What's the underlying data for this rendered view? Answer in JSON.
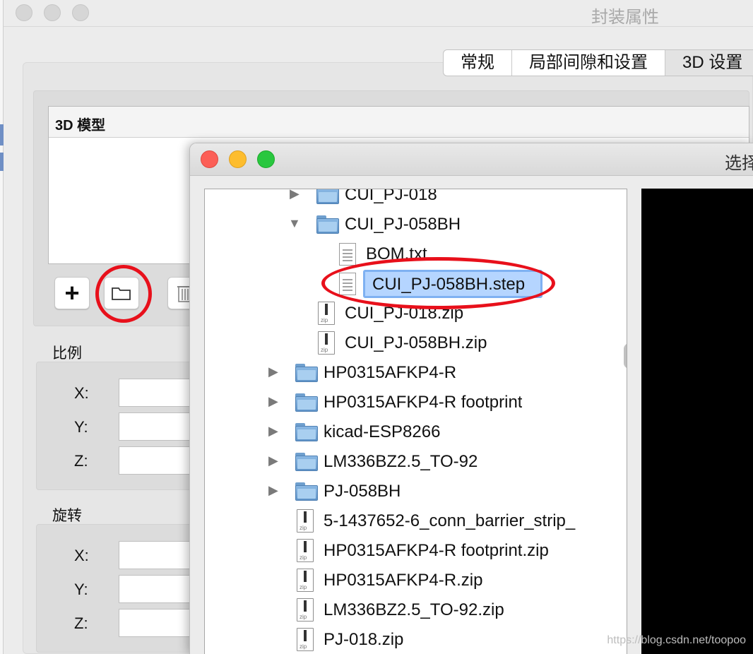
{
  "back_window": {
    "title": "封装属性",
    "tabs": [
      {
        "label": "常规"
      },
      {
        "label": "局部间隙和设置"
      },
      {
        "label": "3D 设置"
      }
    ],
    "model_list_header": "3D 模型",
    "toolbar": {
      "add_icon": "plus-icon",
      "open_icon": "folder-icon",
      "delete_icon": "trash-icon"
    },
    "scale": {
      "label": "比例",
      "axes": [
        {
          "label": "X:"
        },
        {
          "label": "Y:"
        },
        {
          "label": "Z:"
        }
      ]
    },
    "rotation": {
      "label": "旋转",
      "axes": [
        {
          "label": "X:"
        },
        {
          "label": "Y:"
        },
        {
          "label": "Z:"
        }
      ]
    }
  },
  "dialog": {
    "title": "选择",
    "tree": [
      {
        "label": "CUI_PJ-018",
        "type": "folder",
        "expanded": false
      },
      {
        "label": "CUI_PJ-058BH",
        "type": "folder",
        "expanded": true
      },
      {
        "label": "BOM.txt",
        "type": "text-file"
      },
      {
        "label": "CUI_PJ-058BH.step",
        "type": "text-file",
        "editing": true
      },
      {
        "label": "CUI_PJ-018.zip",
        "type": "zip-file"
      },
      {
        "label": "CUI_PJ-058BH.zip",
        "type": "zip-file"
      },
      {
        "label": "HP0315AFKP4-R",
        "type": "folder",
        "expanded": false
      },
      {
        "label": "HP0315AFKP4-R footprint",
        "type": "folder",
        "expanded": false
      },
      {
        "label": "kicad-ESP8266",
        "type": "folder",
        "expanded": false
      },
      {
        "label": "LM336BZ2.5_TO-92",
        "type": "folder",
        "expanded": false
      },
      {
        "label": "PJ-058BH",
        "type": "folder",
        "expanded": false
      },
      {
        "label": "5-1437652-6_conn_barrier_strip_",
        "type": "zip-file"
      },
      {
        "label": "HP0315AFKP4-R footprint.zip",
        "type": "zip-file"
      },
      {
        "label": "HP0315AFKP4-R.zip",
        "type": "zip-file"
      },
      {
        "label": "LM336BZ2.5_TO-92.zip",
        "type": "zip-file"
      },
      {
        "label": "PJ-018.zip",
        "type": "zip-file"
      }
    ]
  },
  "annotation_color": "#e8101b",
  "watermark": "https://blog.csdn.net/toopoo"
}
